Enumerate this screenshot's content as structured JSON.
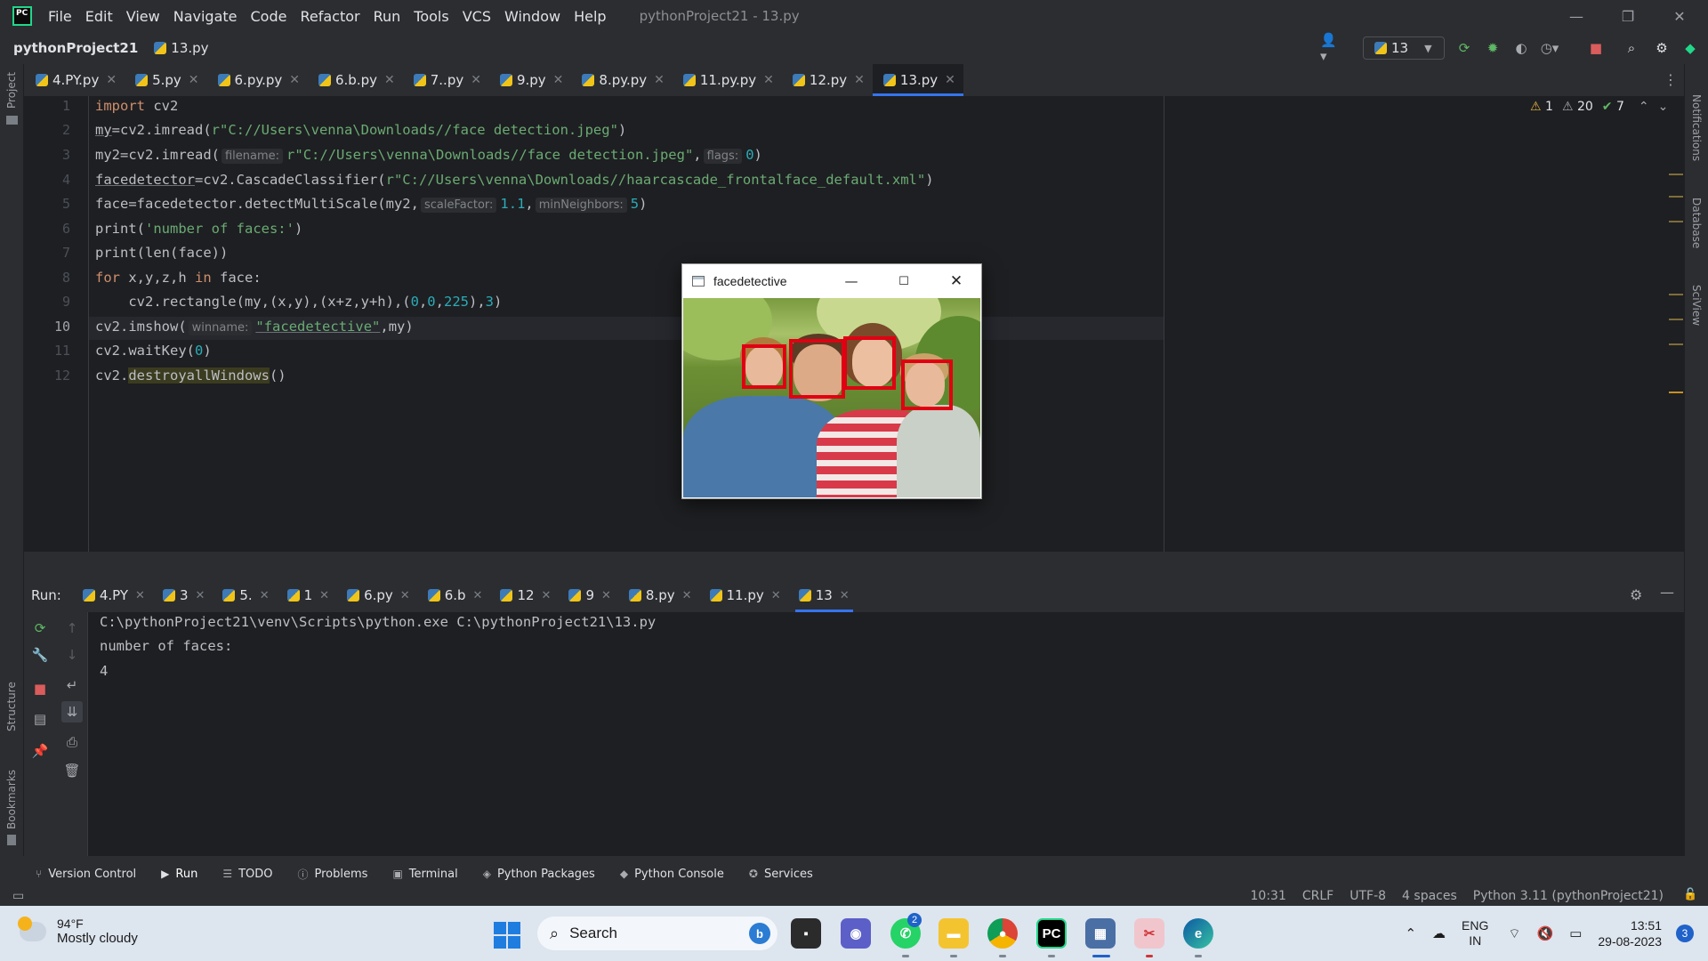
{
  "menu": [
    "File",
    "Edit",
    "View",
    "Navigate",
    "Code",
    "Refactor",
    "Run",
    "Tools",
    "VCS",
    "Window",
    "Help"
  ],
  "window_title": "pythonProject21 - 13.py",
  "nav": {
    "project": "pythonProject21",
    "file": "13.py",
    "run_config": "13"
  },
  "editor_tabs": [
    "4.PY.py",
    "5.py",
    "6.py.py",
    "6.b.py",
    "7..py",
    "9.py",
    "8.py.py",
    "11.py.py",
    "12.py",
    "13.py"
  ],
  "active_editor_tab": "13.py",
  "inspections": {
    "warnings_a": "1",
    "warnings_b": "20",
    "ok": "7"
  },
  "side_labels": {
    "project": "Project",
    "structure": "Structure",
    "bookmarks": "Bookmarks",
    "notifications": "Notifications",
    "database": "Database",
    "sciview": "SciView"
  },
  "code": {
    "line_numbers": [
      "1",
      "2",
      "3",
      "4",
      "5",
      "6",
      "7",
      "8",
      "9",
      "10",
      "11",
      "12"
    ],
    "l1_kw": "import",
    "l1_rest": " cv2",
    "l2_a": "my",
    "l2_b": "=cv2.imread(",
    "l2_str": "r\"C://Users\\venna\\Downloads//face detection.jpeg\"",
    "l2_c": ")",
    "l3_a": "my2=cv2.imread(",
    "l3_hint1": "filename:",
    "l3_str": "r\"C://Users\\venna\\Downloads//face detection.jpeg\"",
    "l3_b": ",",
    "l3_hint2": "flags:",
    "l3_num": "0",
    "l3_c": ")",
    "l4_a": "facedetector",
    "l4_b": "=cv2.CascadeClassifier(",
    "l4_str": "r\"C://Users\\venna\\Downloads//haarcascade_frontalface_default.xml\"",
    "l4_c": ")",
    "l5_a": "face=facedetector.detectMultiScale(my2,",
    "l5_hint1": "scaleFactor:",
    "l5_num1": "1.1",
    "l5_b": ",",
    "l5_hint2": "minNeighbors:",
    "l5_num2": "5",
    "l5_c": ")",
    "l6_a": "print(",
    "l6_str": "'number of faces:'",
    "l6_b": ")",
    "l7": "print(len(face))",
    "l8_kw1": "for",
    "l8_a": " x,y,z,h ",
    "l8_kw2": "in",
    "l8_b": " face:",
    "l9_a": "    cv2.rectangle(my,(x,y),(x+z,y+h),(",
    "l9_n1": "0",
    "l9_sep1": ",",
    "l9_n2": "0",
    "l9_sep2": ",",
    "l9_n3": "225",
    "l9_b": "),",
    "l9_n4": "3",
    "l9_c": ")",
    "l10_a": "cv2.imshow(",
    "l10_hint": "winname:",
    "l10_str": "\"facedetective\"",
    "l10_b": ",my)",
    "l11_a": "cv2.waitKey(",
    "l11_num": "0",
    "l11_b": ")",
    "l12_a": "cv2.",
    "l12_b": "destroyallWindows",
    "l12_c": "()"
  },
  "cv_window": {
    "title": "facedetective",
    "detected_faces": 4
  },
  "run": {
    "label": "Run:",
    "tabs": [
      "4.PY",
      "3",
      "5.",
      "1",
      "6.py",
      "6.b",
      "12",
      "9",
      "8.py",
      "11.py",
      "13"
    ],
    "active_tab": "13",
    "output": [
      "C:\\pythonProject21\\venv\\Scripts\\python.exe C:\\pythonProject21\\13.py",
      "number of faces:",
      "4"
    ]
  },
  "bottom_tools": [
    "Version Control",
    "Run",
    "TODO",
    "Problems",
    "Terminal",
    "Python Packages",
    "Python Console",
    "Services"
  ],
  "status": {
    "position": "10:31",
    "line_sep": "CRLF",
    "encoding": "UTF-8",
    "indent": "4 spaces",
    "interpreter": "Python 3.11 (pythonProject21)"
  },
  "taskbar": {
    "weather_temp": "94°F",
    "weather_desc": "Mostly cloudy",
    "search_label": "Search",
    "whatsapp_badge": "2",
    "lang_1": "ENG",
    "lang_2": "IN",
    "time": "13:51",
    "date": "29-08-2023",
    "notifications": "3"
  },
  "colors": {
    "accent": "#3574f0",
    "keyword": "#cf8e6d",
    "string": "#6aab73",
    "number": "#2aacb8",
    "detect_box": "#e00012"
  }
}
